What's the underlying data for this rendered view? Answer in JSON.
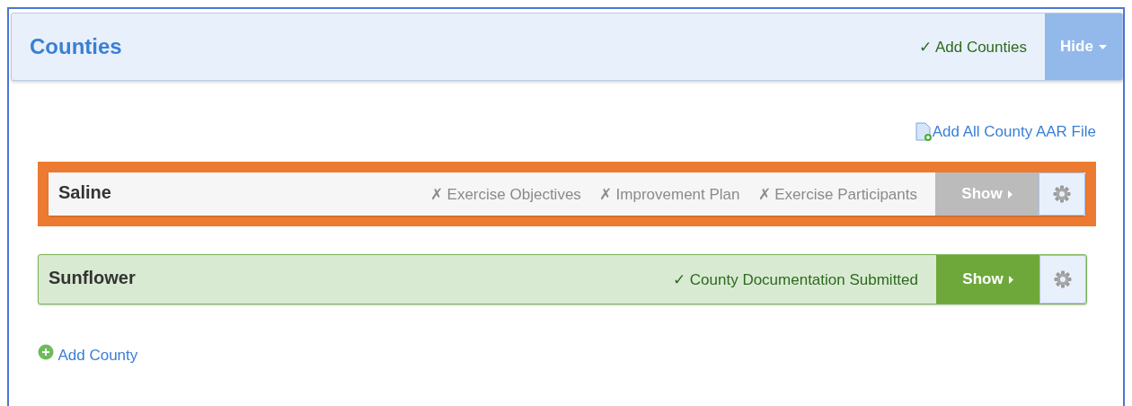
{
  "panel": {
    "title": "Counties",
    "status": {
      "mark": "✓",
      "text": "Add Counties",
      "done": true
    },
    "hide_button": "Hide"
  },
  "add_file_link": "Add All County AAR File",
  "counties": [
    {
      "name": "Saline",
      "complete": false,
      "highlighted": true,
      "items": [
        {
          "mark": "✗",
          "text": "Exercise Objectives",
          "done": false
        },
        {
          "mark": "✗",
          "text": "Improvement Plan",
          "done": false
        },
        {
          "mark": "✗",
          "text": "Exercise Participants",
          "done": false
        }
      ],
      "show_button": "Show"
    },
    {
      "name": "Sunflower",
      "complete": true,
      "highlighted": false,
      "items": [
        {
          "mark": "✓",
          "text": "County Documentation Submitted",
          "done": true
        }
      ],
      "show_button": "Show"
    }
  ],
  "add_county_link": "Add County"
}
